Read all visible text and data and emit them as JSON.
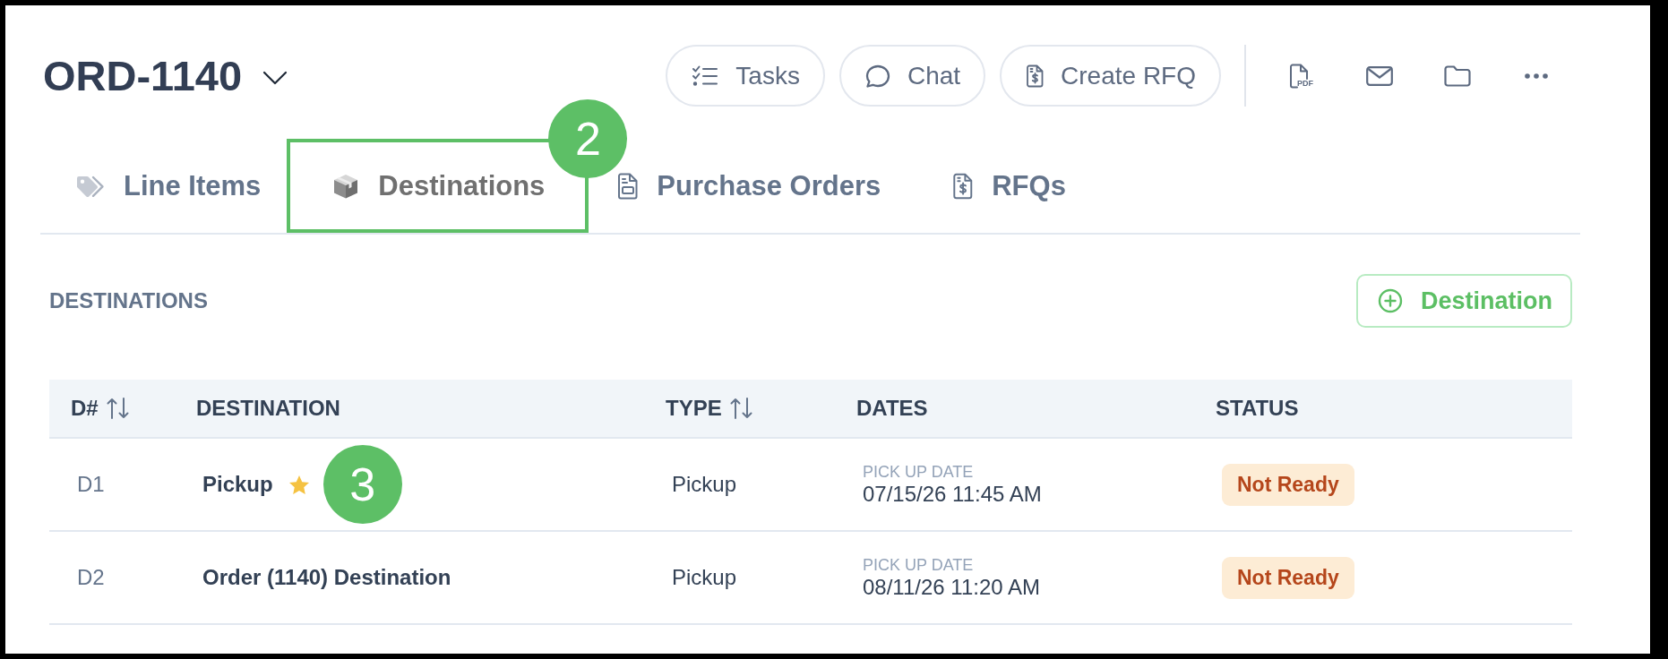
{
  "header": {
    "title": "ORD-1140",
    "actions": [
      {
        "label": "Tasks"
      },
      {
        "label": "Chat"
      },
      {
        "label": "Create RFQ"
      }
    ],
    "export_label": "PDF"
  },
  "tabs": [
    {
      "label": "Line Items",
      "selected": false,
      "highlighted": false
    },
    {
      "label": "Destinations",
      "selected": true,
      "highlighted": true,
      "callout": "2"
    },
    {
      "label": "Purchase Orders",
      "selected": false,
      "highlighted": false
    },
    {
      "label": "RFQs",
      "selected": false,
      "highlighted": false
    }
  ],
  "section": {
    "title": "DESTINATIONS",
    "add_label": "Destination"
  },
  "table": {
    "columns": [
      {
        "label": "D#",
        "sortable": true
      },
      {
        "label": "DESTINATION",
        "sortable": false
      },
      {
        "label": "TYPE",
        "sortable": true
      },
      {
        "label": "DATES",
        "sortable": false
      },
      {
        "label": "STATUS",
        "sortable": false
      }
    ],
    "rows": [
      {
        "id": "D1",
        "destination": "Pickup",
        "starred": true,
        "callout": "3",
        "type": "Pickup",
        "date_label": "PICK UP DATE",
        "date": "07/15/26 11:45 AM",
        "status": "Not Ready"
      },
      {
        "id": "D2",
        "destination": "Order (1140) Destination",
        "starred": false,
        "type": "Pickup",
        "date_label": "PICK UP DATE",
        "date": "08/11/26 11:20 AM",
        "status": "Not Ready"
      }
    ]
  }
}
